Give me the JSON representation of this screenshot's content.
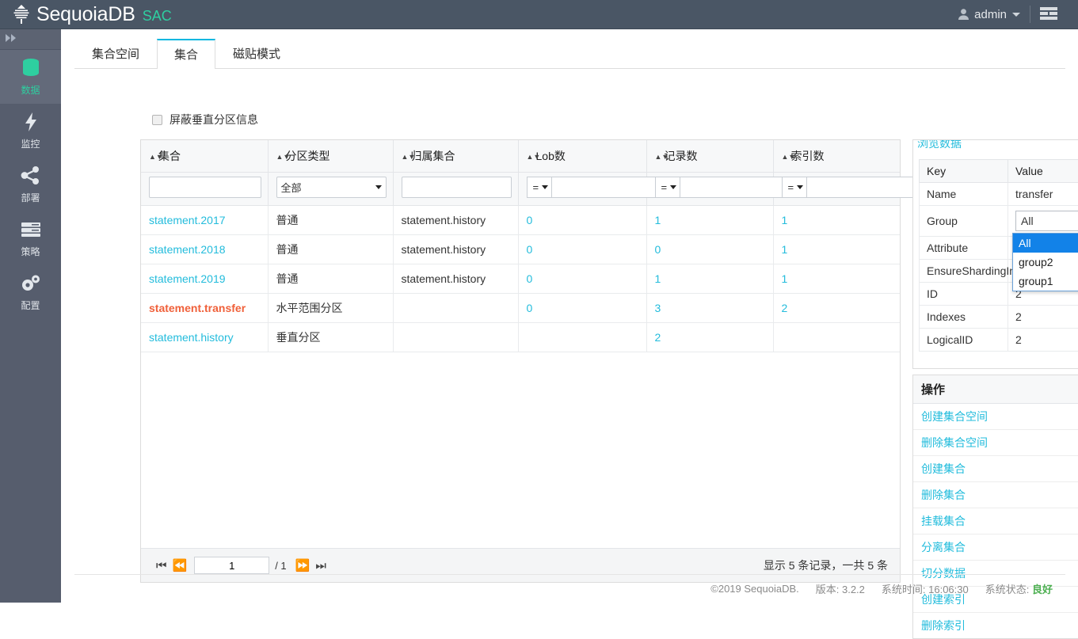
{
  "header": {
    "brand": "SequoiaDB",
    "brand_sub": "SAC",
    "logo_icon": "tree-logo-icon",
    "user": "admin",
    "user_icon": "user-icon",
    "menu_icon": "menu-icon",
    "bg_color": "#4a5665",
    "accent_color": "#2ecfa0"
  },
  "sidebar": {
    "collapse_icon": "double-chevron-right-icon",
    "items": [
      {
        "label": "数据",
        "icon": "database-icon",
        "active": true
      },
      {
        "label": "监控",
        "icon": "bolt-icon",
        "active": false
      },
      {
        "label": "部署",
        "icon": "share-nodes-icon",
        "active": false
      },
      {
        "label": "策略",
        "icon": "server-rack-icon",
        "active": false
      },
      {
        "label": "配置",
        "icon": "gears-icon",
        "active": false
      }
    ]
  },
  "tabs": [
    {
      "label": "集合空间",
      "active": false
    },
    {
      "label": "集合",
      "active": true
    },
    {
      "label": "磁贴模式",
      "active": false
    }
  ],
  "toolbar": {
    "checkbox_label": "屏蔽垂直分区信息",
    "checkbox_checked": false
  },
  "table": {
    "columns": [
      {
        "label": "集合",
        "filter": "text",
        "value": ""
      },
      {
        "label": "分区类型",
        "filter": "select",
        "value": "全部"
      },
      {
        "label": "归属集合",
        "filter": "text",
        "value": ""
      },
      {
        "label": "Lob数",
        "filter": "op",
        "op": "=",
        "value": ""
      },
      {
        "label": "记录数",
        "filter": "op",
        "op": "=",
        "value": ""
      },
      {
        "label": "索引数",
        "filter": "op",
        "op": "=",
        "value": ""
      }
    ],
    "rows": [
      {
        "name": "statement.2017",
        "selected": false,
        "type": "普通",
        "parent": "statement.history",
        "lob": "0",
        "records": "1",
        "indexes": "1"
      },
      {
        "name": "statement.2018",
        "selected": false,
        "type": "普通",
        "parent": "statement.history",
        "lob": "0",
        "records": "0",
        "indexes": "1"
      },
      {
        "name": "statement.2019",
        "selected": false,
        "type": "普通",
        "parent": "statement.history",
        "lob": "0",
        "records": "1",
        "indexes": "1"
      },
      {
        "name": "statement.transfer",
        "selected": true,
        "type": "水平范围分区",
        "parent": "",
        "lob": "0",
        "records": "3",
        "indexes": "2"
      },
      {
        "name": "statement.history",
        "selected": false,
        "type": "垂直分区",
        "parent": "",
        "lob": "",
        "records": "2",
        "indexes": ""
      }
    ]
  },
  "pagination": {
    "first_icon": "first-page-icon",
    "prev_icon": "prev-page-icon",
    "next_icon": "next-page-icon",
    "last_icon": "last-page-icon",
    "page": "1",
    "total_pages": "/ 1",
    "summary": "显示 5 条记录，一共 5 条"
  },
  "detail": {
    "title": "浏览数据",
    "col_key": "Key",
    "col_value": "Value",
    "rows": [
      {
        "key": "Name",
        "value": "transfer",
        "type": "text"
      },
      {
        "key": "Group",
        "value": "All",
        "type": "select"
      },
      {
        "key": "Attribute",
        "value": "",
        "type": "text"
      },
      {
        "key": "EnsureShardingIndex",
        "value": "true",
        "type": "text"
      },
      {
        "key": "ID",
        "value": "2",
        "type": "text"
      },
      {
        "key": "Indexes",
        "value": "2",
        "type": "text"
      },
      {
        "key": "LogicalID",
        "value": "2",
        "type": "text"
      }
    ],
    "group_options": [
      {
        "label": "All",
        "selected": true
      },
      {
        "label": "group2",
        "selected": false
      },
      {
        "label": "group1",
        "selected": false
      }
    ],
    "scroll_up_icon": "scroll-up-arrow-icon",
    "scroll_down_icon": "scroll-down-arrow-icon"
  },
  "operations": {
    "title": "操作",
    "items": [
      "创建集合空间",
      "删除集合空间",
      "创建集合",
      "删除集合",
      "挂载集合",
      "分离集合",
      "切分数据",
      "创建索引",
      "删除索引"
    ]
  },
  "footer": {
    "copyright": "©2019 SequoiaDB.",
    "version": "版本: 3.2.2",
    "sys_time": "系统时间: 16:06:30",
    "status_label": "系统状态:",
    "status_value": "良好",
    "status_color": "#4caf50"
  }
}
